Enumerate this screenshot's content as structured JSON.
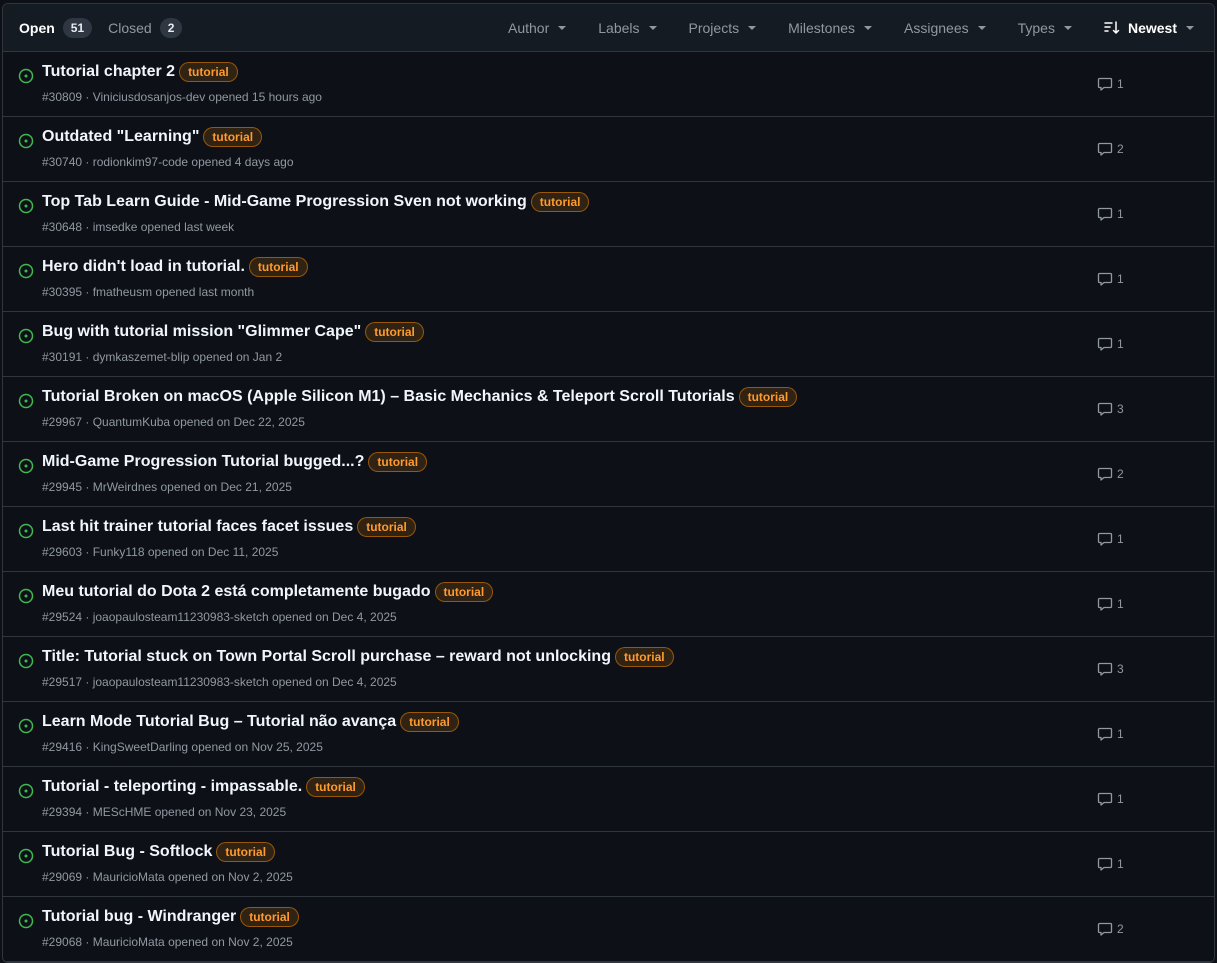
{
  "tabs": {
    "open_label": "Open",
    "open_count": "51",
    "closed_label": "Closed",
    "closed_count": "2"
  },
  "filters": [
    "Author",
    "Labels",
    "Projects",
    "Milestones",
    "Assignees",
    "Types"
  ],
  "sort_label": "Newest",
  "colors": {
    "open_icon": "#3fb950",
    "label_text": "#ff9a2e"
  },
  "issues": [
    {
      "title": "Tutorial chapter 2",
      "label": "tutorial",
      "meta": "#30809 · Viniciusdosanjos-dev opened 15 hours ago",
      "comments": "1"
    },
    {
      "title": "Outdated \"Learning\"",
      "label": "tutorial",
      "meta": "#30740 · rodionkim97-code opened 4 days ago",
      "comments": "2"
    },
    {
      "title": "Top Tab Learn Guide - Mid-Game Progression Sven not working",
      "label": "tutorial",
      "meta": "#30648 · imsedke opened last week",
      "comments": "1"
    },
    {
      "title": "Hero didn't load in tutorial.",
      "label": "tutorial",
      "meta": "#30395 · fmatheusm opened last month",
      "comments": "1"
    },
    {
      "title": "Bug with tutorial mission \"Glimmer Cape\"",
      "label": "tutorial",
      "meta": "#30191 · dymkaszemet-blip opened on Jan 2",
      "comments": "1"
    },
    {
      "title": "Tutorial Broken on macOS (Apple Silicon M1) – Basic Mechanics & Teleport Scroll Tutorials",
      "label": "tutorial",
      "meta": "#29967 · QuantumKuba opened on Dec 22, 2025",
      "comments": "3"
    },
    {
      "title": "Mid-Game Progression Tutorial bugged...?",
      "label": "tutorial",
      "meta": "#29945 · MrWeirdnes opened on Dec 21, 2025",
      "comments": "2"
    },
    {
      "title": "Last hit trainer tutorial faces facet issues",
      "label": "tutorial",
      "meta": "#29603 · Funky118 opened on Dec 11, 2025",
      "comments": "1"
    },
    {
      "title": "Meu tutorial do Dota 2 está completamente bugado",
      "label": "tutorial",
      "meta": "#29524 · joaopaulosteam11230983-sketch opened on Dec 4, 2025",
      "comments": "1"
    },
    {
      "title": "Title: Tutorial stuck on Town Portal Scroll purchase – reward not unlocking",
      "label": "tutorial",
      "meta": "#29517 · joaopaulosteam11230983-sketch opened on Dec 4, 2025",
      "comments": "3"
    },
    {
      "title": "Learn Mode Tutorial Bug – Tutorial não avança",
      "label": "tutorial",
      "meta": "#29416 · KingSweetDarling opened on Nov 25, 2025",
      "comments": "1"
    },
    {
      "title": "Tutorial - teleporting - impassable.",
      "label": "tutorial",
      "meta": "#29394 · MEScHME opened on Nov 23, 2025",
      "comments": "1"
    },
    {
      "title": "Tutorial Bug - Softlock",
      "label": "tutorial",
      "meta": "#29069 · MauricioMata opened on Nov 2, 2025",
      "comments": "1"
    },
    {
      "title": "Tutorial bug - Windranger",
      "label": "tutorial",
      "meta": "#29068 · MauricioMata opened on Nov 2, 2025",
      "comments": "2"
    }
  ]
}
